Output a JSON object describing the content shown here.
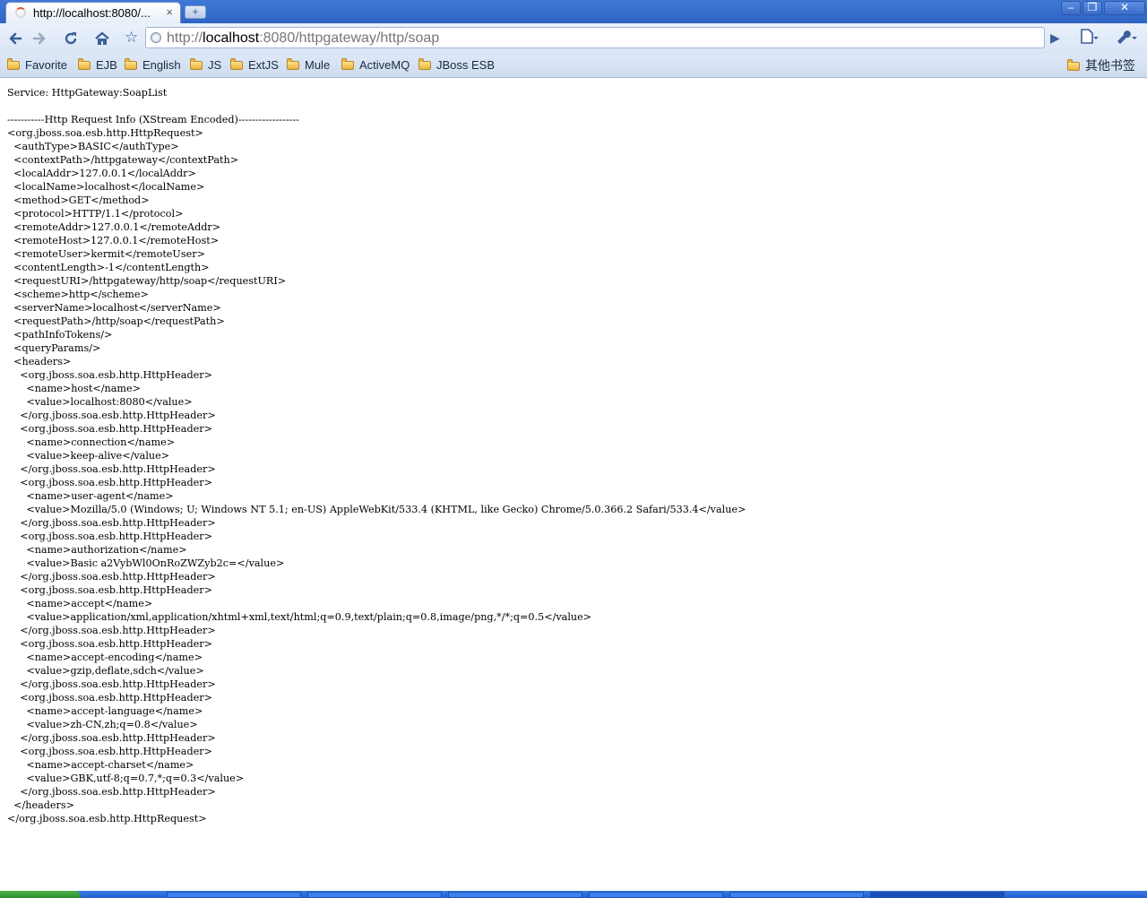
{
  "tab": {
    "title": "http://localhost:8080/...",
    "close_glyph": "×",
    "new_tab_glyph": "+"
  },
  "window_controls": {
    "minimize": "–",
    "maximize": "❐",
    "close": "✕"
  },
  "toolbar": {
    "back_icon": "arrow-left-icon",
    "forward_icon": "arrow-right-icon",
    "reload_icon": "reload-icon",
    "home_icon": "home-icon",
    "star_icon": "star-icon"
  },
  "address": {
    "scheme": "http://",
    "host": "localhost",
    "rest": ":8080/httpgateway/http/soap"
  },
  "bookmarks": {
    "items": [
      "Favorite",
      "EJB",
      "English",
      "JS",
      "ExtJS",
      "Mule",
      "ActiveMQ",
      "JBoss ESB"
    ],
    "other": "其他书签"
  },
  "content": {
    "text": "Service: HttpGateway:SoapList\n\n-----------Http Request Info (XStream Encoded)------------------\n<org.jboss.soa.esb.http.HttpRequest>\n  <authType>BASIC</authType>\n  <contextPath>/httpgateway</contextPath>\n  <localAddr>127.0.0.1</localAddr>\n  <localName>localhost</localName>\n  <method>GET</method>\n  <protocol>HTTP/1.1</protocol>\n  <remoteAddr>127.0.0.1</remoteAddr>\n  <remoteHost>127.0.0.1</remoteHost>\n  <remoteUser>kermit</remoteUser>\n  <contentLength>-1</contentLength>\n  <requestURI>/httpgateway/http/soap</requestURI>\n  <scheme>http</scheme>\n  <serverName>localhost</serverName>\n  <requestPath>/http/soap</requestPath>\n  <pathInfoTokens/>\n  <queryParams/>\n  <headers>\n    <org.jboss.soa.esb.http.HttpHeader>\n      <name>host</name>\n      <value>localhost:8080</value>\n    </org.jboss.soa.esb.http.HttpHeader>\n    <org.jboss.soa.esb.http.HttpHeader>\n      <name>connection</name>\n      <value>keep-alive</value>\n    </org.jboss.soa.esb.http.HttpHeader>\n    <org.jboss.soa.esb.http.HttpHeader>\n      <name>user-agent</name>\n      <value>Mozilla/5.0 (Windows; U; Windows NT 5.1; en-US) AppleWebKit/533.4 (KHTML, like Gecko) Chrome/5.0.366.2 Safari/533.4</value>\n    </org.jboss.soa.esb.http.HttpHeader>\n    <org.jboss.soa.esb.http.HttpHeader>\n      <name>authorization</name>\n      <value>Basic a2VybWl0OnRoZWZyb2c=</value>\n    </org.jboss.soa.esb.http.HttpHeader>\n    <org.jboss.soa.esb.http.HttpHeader>\n      <name>accept</name>\n      <value>application/xml,application/xhtml+xml,text/html;q=0.9,text/plain;q=0.8,image/png,*/*;q=0.5</value>\n    </org.jboss.soa.esb.http.HttpHeader>\n    <org.jboss.soa.esb.http.HttpHeader>\n      <name>accept-encoding</name>\n      <value>gzip,deflate,sdch</value>\n    </org.jboss.soa.esb.http.HttpHeader>\n    <org.jboss.soa.esb.http.HttpHeader>\n      <name>accept-language</name>\n      <value>zh-CN,zh;q=0.8</value>\n    </org.jboss.soa.esb.http.HttpHeader>\n    <org.jboss.soa.esb.http.HttpHeader>\n      <name>accept-charset</name>\n      <value>GBK,utf-8;q=0.7,*;q=0.3</value>\n    </org.jboss.soa.esb.http.HttpHeader>\n  </headers>\n</org.jboss.soa.esb.http.HttpRequest>"
  }
}
